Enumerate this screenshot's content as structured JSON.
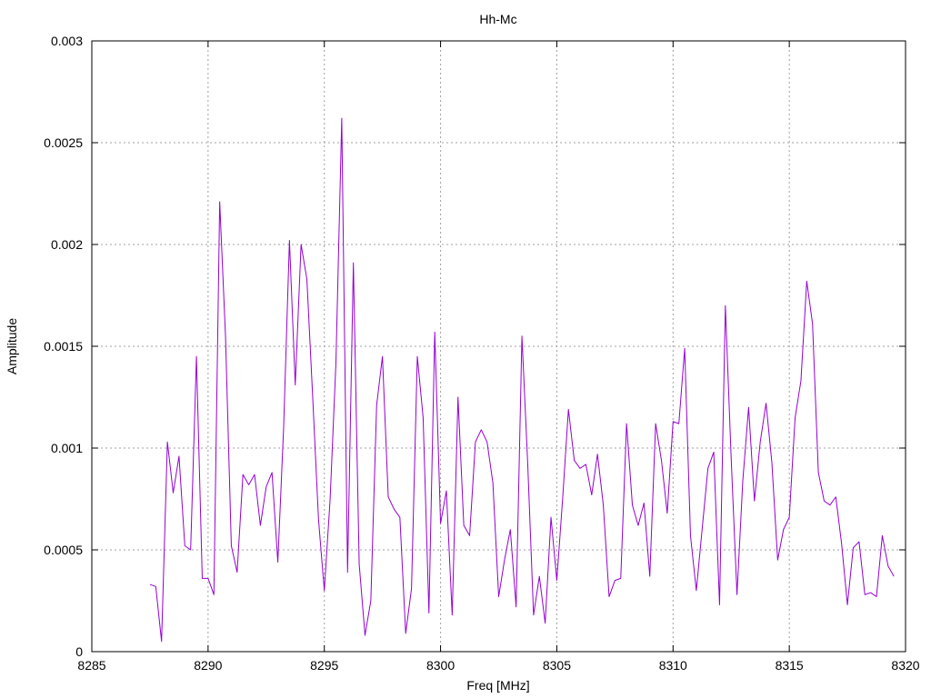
{
  "chart_data": {
    "type": "line",
    "title": "Hh-Mc",
    "xlabel": "Freq [MHz]",
    "ylabel": "Amplitude",
    "xlim": [
      8285,
      8320
    ],
    "ylim": [
      0,
      0.003
    ],
    "xticks": [
      {
        "value": 8285,
        "label": "8285"
      },
      {
        "value": 8290,
        "label": "8290"
      },
      {
        "value": 8295,
        "label": "8295"
      },
      {
        "value": 8300,
        "label": "8300"
      },
      {
        "value": 8305,
        "label": "8305"
      },
      {
        "value": 8310,
        "label": "8310"
      },
      {
        "value": 8315,
        "label": "8315"
      },
      {
        "value": 8320,
        "label": "8320"
      }
    ],
    "yticks": [
      {
        "value": 0,
        "label": "0"
      },
      {
        "value": 0.0005,
        "label": "0.0005"
      },
      {
        "value": 0.001,
        "label": "0.001"
      },
      {
        "value": 0.0015,
        "label": "0.0015"
      },
      {
        "value": 0.002,
        "label": "0.002"
      },
      {
        "value": 0.0025,
        "label": "0.0025"
      },
      {
        "value": 0.003,
        "label": "0.003"
      }
    ],
    "grid": true,
    "series": [
      {
        "color": "#9400d3",
        "x": [
          8287.5,
          8287.75,
          8288.0,
          8288.25,
          8288.5,
          8288.75,
          8289.0,
          8289.25,
          8289.5,
          8289.75,
          8290.0,
          8290.25,
          8290.5,
          8290.75,
          8291.0,
          8291.25,
          8291.5,
          8291.75,
          8292.0,
          8292.25,
          8292.5,
          8292.75,
          8293.0,
          8293.25,
          8293.5,
          8293.75,
          8294.0,
          8294.25,
          8294.5,
          8294.75,
          8295.0,
          8295.25,
          8295.5,
          8295.75,
          8296.0,
          8296.25,
          8296.5,
          8296.75,
          8297.0,
          8297.25,
          8297.5,
          8297.75,
          8298.0,
          8298.25,
          8298.5,
          8298.75,
          8299.0,
          8299.25,
          8299.5,
          8299.75,
          8300.0,
          8300.25,
          8300.5,
          8300.75,
          8301.0,
          8301.25,
          8301.5,
          8301.75,
          8302.0,
          8302.25,
          8302.5,
          8302.75,
          8303.0,
          8303.25,
          8303.5,
          8303.75,
          8304.0,
          8304.25,
          8304.5,
          8304.75,
          8305.0,
          8305.25,
          8305.5,
          8305.75,
          8306.0,
          8306.25,
          8306.5,
          8306.75,
          8307.0,
          8307.25,
          8307.5,
          8307.75,
          8308.0,
          8308.25,
          8308.5,
          8308.75,
          8309.0,
          8309.25,
          8309.5,
          8309.75,
          8310.0,
          8310.25,
          8310.5,
          8310.75,
          8311.0,
          8311.25,
          8311.5,
          8311.75,
          8312.0,
          8312.25,
          8312.5,
          8312.75,
          8313.0,
          8313.25,
          8313.5,
          8313.75,
          8314.0,
          8314.25,
          8314.5,
          8314.75,
          8315.0,
          8315.25,
          8315.5,
          8315.75,
          8316.0,
          8316.25,
          8316.5,
          8316.75,
          8317.0,
          8317.25,
          8317.5,
          8317.75,
          8318.0,
          8318.25,
          8318.5,
          8318.75,
          8319.0,
          8319.25,
          8319.5
        ],
        "y": [
          0.00033,
          0.00032,
          5e-05,
          0.00103,
          0.00078,
          0.00096,
          0.00052,
          0.0005,
          0.00145,
          0.00036,
          0.00036,
          0.00028,
          0.00221,
          0.00155,
          0.00052,
          0.00039,
          0.00087,
          0.00082,
          0.00087,
          0.00062,
          0.00081,
          0.00088,
          0.00044,
          0.0011,
          0.00202,
          0.00131,
          0.002,
          0.00183,
          0.00125,
          0.00065,
          0.0003,
          0.00075,
          0.00142,
          0.00262,
          0.00039,
          0.00191,
          0.00043,
          8e-05,
          0.00025,
          0.00121,
          0.00145,
          0.00076,
          0.0007,
          0.00066,
          9e-05,
          0.00031,
          0.00145,
          0.00115,
          0.00019,
          0.00157,
          0.00063,
          0.00079,
          0.00018,
          0.00125,
          0.00062,
          0.00057,
          0.00103,
          0.00109,
          0.00103,
          0.00083,
          0.00027,
          0.00045,
          0.0006,
          0.00022,
          0.00155,
          0.00092,
          0.00018,
          0.00037,
          0.00014,
          0.00066,
          0.00035,
          0.00075,
          0.00119,
          0.00094,
          0.0009,
          0.00092,
          0.00077,
          0.00097,
          0.00072,
          0.00027,
          0.00035,
          0.00036,
          0.00112,
          0.00072,
          0.00062,
          0.00073,
          0.00037,
          0.00112,
          0.00094,
          0.00068,
          0.00113,
          0.00112,
          0.00149,
          0.00057,
          0.0003,
          0.0006,
          0.0009,
          0.00098,
          0.00023,
          0.0017,
          0.00095,
          0.00028,
          0.00084,
          0.0012,
          0.00074,
          0.00103,
          0.00122,
          0.00093,
          0.00045,
          0.0006,
          0.00066,
          0.00115,
          0.00133,
          0.00182,
          0.00161,
          0.00088,
          0.00074,
          0.00072,
          0.00076,
          0.00053,
          0.00023,
          0.00051,
          0.00054,
          0.00028,
          0.00029,
          0.00027,
          0.00057,
          0.00042,
          0.00037
        ]
      }
    ]
  }
}
